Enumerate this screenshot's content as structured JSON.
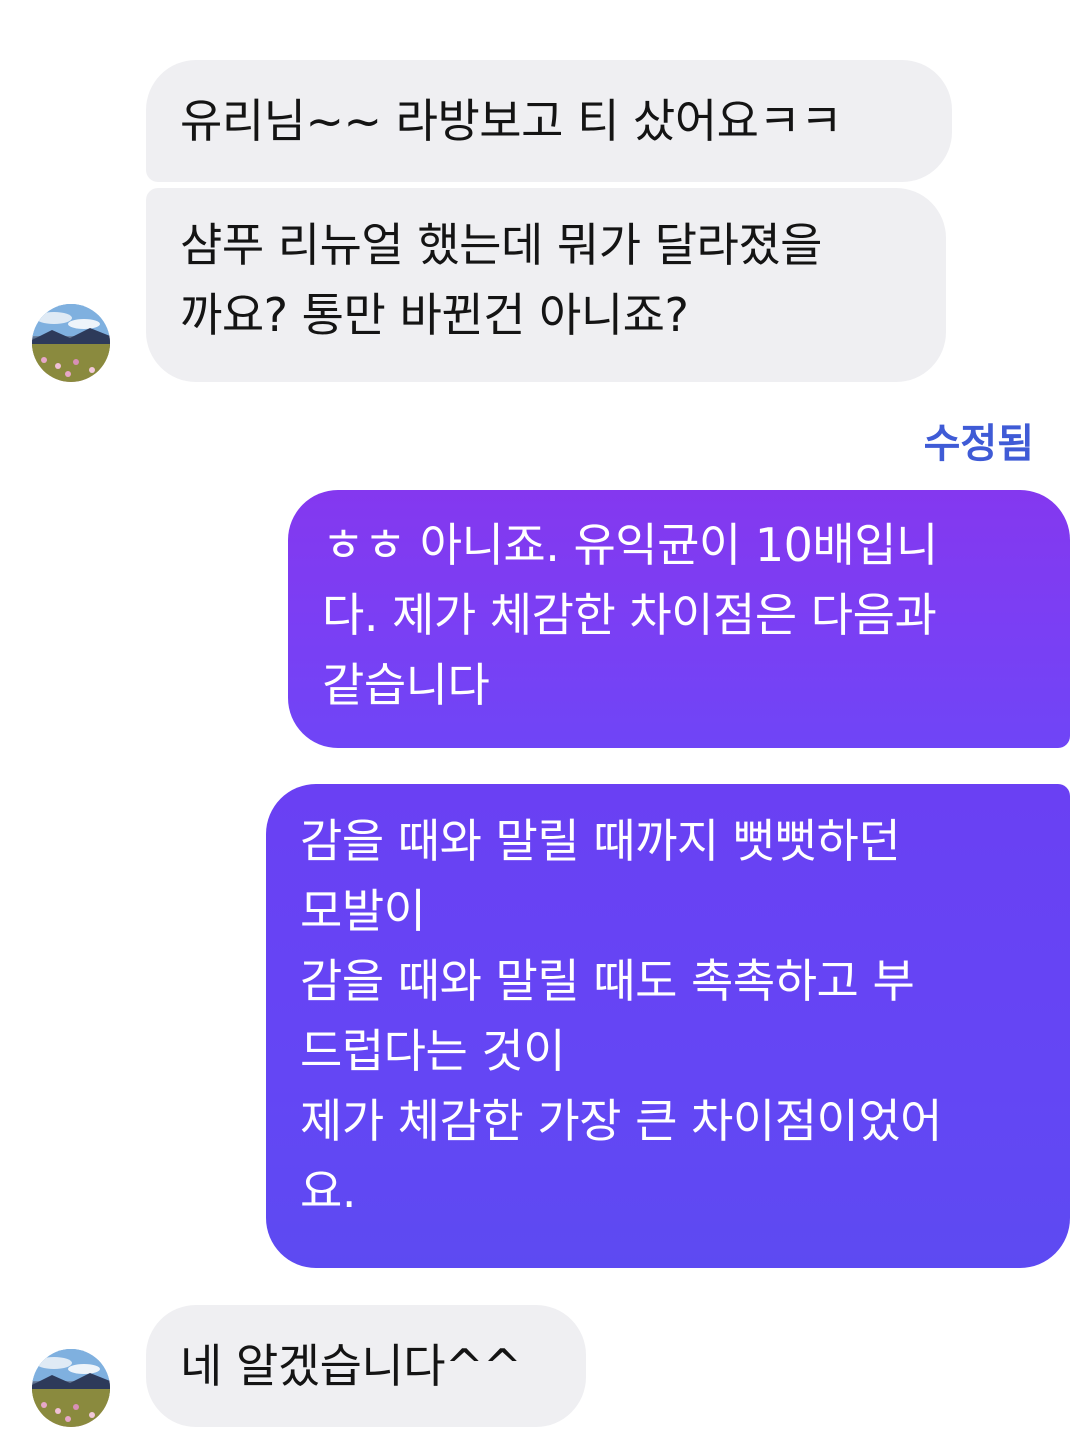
{
  "top_cut_text": "",
  "messages": {
    "incoming_1": "유리님~~ 라방보고 티 샀어요ㅋㅋ",
    "incoming_2_lines": [
      "샴푸 리뉴얼 했는데 뭐가 달라졌을",
      "까요? 통만 바뀐건 아니죠?"
    ],
    "edited_label": "수정됨",
    "outgoing_1_lines": [
      "ㅎㅎ 아니죠. 유익균이 10배입니",
      "다. 제가 체감한 차이점은 다음과",
      "같습니다"
    ],
    "outgoing_2_lines": [
      "감을 때와 말릴 때까지 뻣뻣하던",
      "모발이",
      "감을 때와 말릴 때도 촉촉하고 부",
      "드럽다는 것이",
      "제가 체감한 가장 큰 차이점이었어",
      "요."
    ],
    "incoming_3": "네 알겠습니다^^"
  },
  "colors": {
    "incoming_bubble": "#efeff2",
    "outgoing_gradient_top": "#8438ef",
    "outgoing_gradient_bottom": "#5d4af2",
    "edited_label": "#3f5bd6"
  },
  "icons": {
    "avatar": "avatar-landscape-flowers"
  }
}
